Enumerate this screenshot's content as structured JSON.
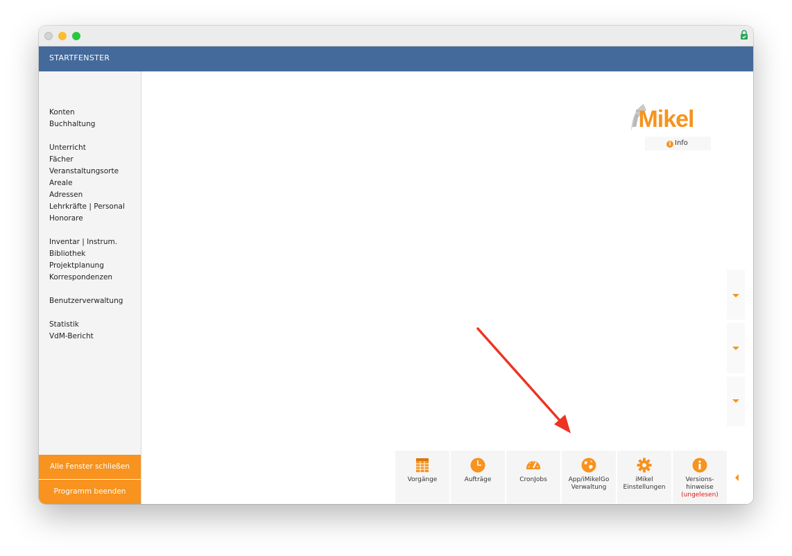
{
  "header": {
    "title": "STARTFENSTER"
  },
  "sidebar": {
    "groups": [
      [
        "Konten",
        "Buchhaltung"
      ],
      [
        "Unterricht",
        "Fächer",
        "Veranstaltungsorte",
        "Areale",
        "Adressen",
        "Lehrkräfte | Personal",
        "Honorare"
      ],
      [
        "Inventar | Instrum.",
        "Bibliothek",
        "Projektplanung",
        "Korrespondenzen"
      ],
      [
        "Benutzerverwaltung"
      ],
      [
        "Statistik",
        "VdM-Bericht"
      ]
    ],
    "close_all_label": "Alle Fenster schließen",
    "quit_label": "Programm beenden"
  },
  "logo": {
    "text_i": "i",
    "text_rest": "Mikel"
  },
  "info": {
    "label": "Info"
  },
  "toolbar": {
    "items": [
      {
        "label": "Vorgänge",
        "icon": "table-icon"
      },
      {
        "label": "Aufträge",
        "icon": "clock-icon"
      },
      {
        "label": "CronJobs",
        "icon": "gauge-icon"
      },
      {
        "label": "App/iMikelGo\nVerwaltung",
        "icon": "globe-icon"
      },
      {
        "label": "iMikel\nEinstellungen",
        "icon": "gear-icon"
      },
      {
        "label": "Versions-\nhinweise",
        "sublabel": "(ungelesen)",
        "icon": "info-icon"
      }
    ]
  },
  "colors": {
    "accent": "#f7931e",
    "header": "#44699b",
    "annotation_arrow": "#ee3322",
    "unread": "#e01a1a"
  }
}
